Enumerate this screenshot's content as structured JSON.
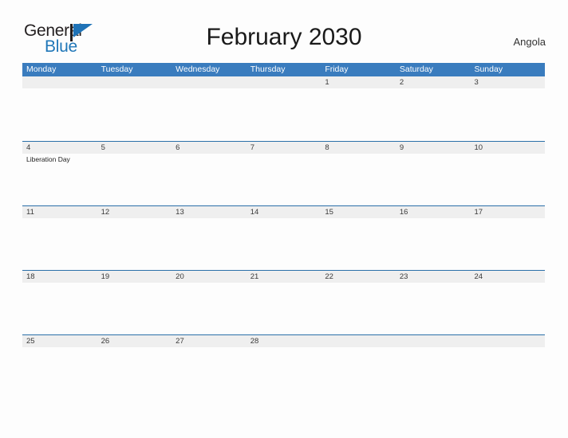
{
  "brand": {
    "name_part1": "General",
    "name_part2": "Blue",
    "flag_icon": "blue-flag-triangle",
    "colors": {
      "dark": "#231f20",
      "blue": "#2077b8"
    }
  },
  "header": {
    "title": "February 2030",
    "country": "Angola"
  },
  "calendar": {
    "accent_color": "#3a7cbe",
    "band_color": "#efefef",
    "rule_color": "#2a6fa8",
    "weekdays": [
      "Monday",
      "Tuesday",
      "Wednesday",
      "Thursday",
      "Friday",
      "Saturday",
      "Sunday"
    ],
    "weeks": [
      {
        "days": [
          {
            "num": "",
            "event": ""
          },
          {
            "num": "",
            "event": ""
          },
          {
            "num": "",
            "event": ""
          },
          {
            "num": "",
            "event": ""
          },
          {
            "num": "1",
            "event": ""
          },
          {
            "num": "2",
            "event": ""
          },
          {
            "num": "3",
            "event": ""
          }
        ]
      },
      {
        "days": [
          {
            "num": "4",
            "event": "Liberation Day"
          },
          {
            "num": "5",
            "event": ""
          },
          {
            "num": "6",
            "event": ""
          },
          {
            "num": "7",
            "event": ""
          },
          {
            "num": "8",
            "event": ""
          },
          {
            "num": "9",
            "event": ""
          },
          {
            "num": "10",
            "event": ""
          }
        ]
      },
      {
        "days": [
          {
            "num": "11",
            "event": ""
          },
          {
            "num": "12",
            "event": ""
          },
          {
            "num": "13",
            "event": ""
          },
          {
            "num": "14",
            "event": ""
          },
          {
            "num": "15",
            "event": ""
          },
          {
            "num": "16",
            "event": ""
          },
          {
            "num": "17",
            "event": ""
          }
        ]
      },
      {
        "days": [
          {
            "num": "18",
            "event": ""
          },
          {
            "num": "19",
            "event": ""
          },
          {
            "num": "20",
            "event": ""
          },
          {
            "num": "21",
            "event": ""
          },
          {
            "num": "22",
            "event": ""
          },
          {
            "num": "23",
            "event": ""
          },
          {
            "num": "24",
            "event": ""
          }
        ]
      },
      {
        "days": [
          {
            "num": "25",
            "event": ""
          },
          {
            "num": "26",
            "event": ""
          },
          {
            "num": "27",
            "event": ""
          },
          {
            "num": "28",
            "event": ""
          },
          {
            "num": "",
            "event": ""
          },
          {
            "num": "",
            "event": ""
          },
          {
            "num": "",
            "event": ""
          }
        ]
      }
    ]
  }
}
